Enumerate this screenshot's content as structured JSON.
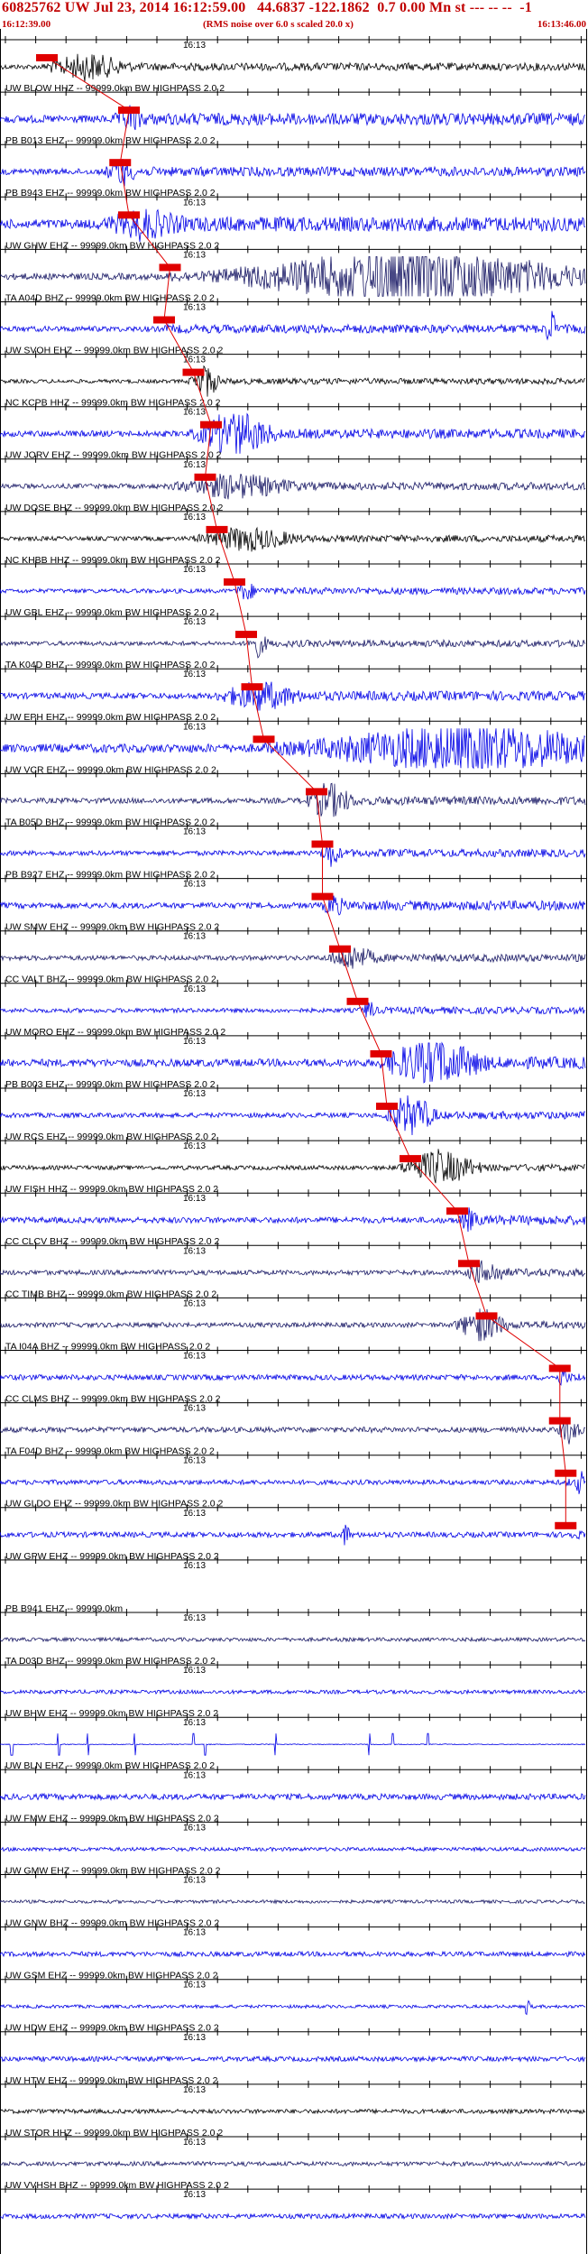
{
  "header": {
    "title": "60825762 UW Jul 23, 2014 16:12:59.00   44.6837 -122.1862  0.7 0.00 Mn st --- -- --  -1",
    "start_time": "16:12:39.00",
    "rms_note": "(RMS noise over 6.0 s scaled 20.0 x)",
    "end_time": "16:13:46.00"
  },
  "colors": {
    "trace_blue": "#0000e6",
    "trace_navy": "#1a1a66",
    "trace_black": "#000000",
    "pick_red": "#e00000",
    "axis": "#000000"
  },
  "time_tick_label": "16:13",
  "traces": [
    {
      "label": "UW BLOW HHZ -- 99999.0km BW  HIGHPASS  2.0  2",
      "color": "black",
      "pick": 0.08,
      "amp": 0.45,
      "burst_at": 0.15,
      "burst_w": 0.08,
      "burst_amp": 2.2,
      "show_tick": true
    },
    {
      "label": "PB B013 EHZ -- 99999.0km BW  HIGHPASS  2.0  2",
      "color": "blue",
      "pick": 0.22,
      "amp": 0.7,
      "burst_at": 0.22,
      "burst_w": 0.03,
      "burst_amp": 2.0,
      "show_tick": false
    },
    {
      "label": "PB B943 EHZ -- 99999.0km BW  HIGHPASS  2.0  2",
      "color": "blue",
      "pick": 0.205,
      "amp": 0.55,
      "burst_at": 0.205,
      "burst_w": 0.03,
      "burst_amp": 2.5,
      "show_tick": false
    },
    {
      "label": "UW GHW EHZ -- 99999.0km BW  HIGHPASS  2.0  2",
      "color": "blue",
      "pick": 0.22,
      "amp": 0.85,
      "burst_at": 0.24,
      "burst_w": 0.08,
      "burst_amp": 2.0,
      "show_tick": true
    },
    {
      "label": "TA A04D BHZ -- 99999.0km BW  HIGHPASS  2.0  2",
      "color": "navy",
      "pick": 0.29,
      "amp": 0.6,
      "burst_at": 0.7,
      "burst_w": 0.35,
      "burst_amp": 5.0,
      "show_tick": true
    },
    {
      "label": "UW SVOH EHZ -- 99999.0km BW  HIGHPASS  2.0  2",
      "color": "blue",
      "pick": 0.28,
      "amp": 0.5,
      "burst_at": 0.94,
      "burst_w": 0.01,
      "burst_amp": 4.0,
      "show_tick": true
    },
    {
      "label": "NC KCPB HHZ -- 99999.0km BW  HIGHPASS  2.0  2",
      "color": "black",
      "pick": 0.33,
      "amp": 0.35,
      "burst_at": 0.35,
      "burst_w": 0.03,
      "burst_amp": 3.0,
      "show_tick": true
    },
    {
      "label": "UW JORV EHZ -- 99999.0km BW  HIGHPASS  2.0  2",
      "color": "blue",
      "pick": 0.36,
      "amp": 0.55,
      "burst_at": 0.4,
      "burst_w": 0.08,
      "burst_amp": 4.0,
      "show_tick": true
    },
    {
      "label": "UW DOSE BHZ -- 99999.0km BW  HIGHPASS  2.0  2",
      "color": "navy",
      "pick": 0.35,
      "amp": 0.45,
      "burst_at": 0.4,
      "burst_w": 0.12,
      "burst_amp": 2.0,
      "show_tick": true
    },
    {
      "label": "NC KHBB HHZ -- 99999.0km BW  HIGHPASS  2.0  2",
      "color": "black",
      "pick": 0.37,
      "amp": 0.4,
      "burst_at": 0.42,
      "burst_w": 0.1,
      "burst_amp": 2.0,
      "show_tick": true
    },
    {
      "label": "UW GBL EHZ -- 99999.0km BW  HIGHPASS  2.0  2",
      "color": "blue",
      "pick": 0.4,
      "amp": 0.4,
      "burst_at": 0.42,
      "burst_w": 0.02,
      "burst_amp": 1.5,
      "show_tick": true
    },
    {
      "label": "TA K04D BHZ -- 99999.0km BW  HIGHPASS  2.0  2",
      "color": "navy",
      "pick": 0.42,
      "amp": 0.4,
      "burst_at": 0.44,
      "burst_w": 0.02,
      "burst_amp": 2.0,
      "show_tick": true
    },
    {
      "label": "UW EPH EHZ -- 99999.0km BW  HIGHPASS  2.0  2",
      "color": "blue",
      "pick": 0.43,
      "amp": 0.55,
      "burst_at": 0.44,
      "burst_w": 0.08,
      "burst_amp": 2.5,
      "show_tick": true
    },
    {
      "label": "UW VCR EHZ -- 99999.0km BW  HIGHPASS  2.0  2",
      "color": "blue",
      "pick": 0.45,
      "amp": 0.8,
      "burst_at": 0.8,
      "burst_w": 0.3,
      "burst_amp": 4.0,
      "show_tick": true
    },
    {
      "label": "TA B05D BHZ -- 99999.0km BW  HIGHPASS  2.0  2",
      "color": "navy",
      "pick": 0.54,
      "amp": 0.5,
      "burst_at": 0.56,
      "burst_w": 0.05,
      "burst_amp": 3.0,
      "show_tick": false
    },
    {
      "label": "PB B927 EHZ -- 99999.0km BW  HIGHPASS  2.0  2",
      "color": "blue",
      "pick": 0.55,
      "amp": 0.45,
      "burst_at": 0.565,
      "burst_w": 0.02,
      "burst_amp": 2.0,
      "show_tick": true
    },
    {
      "label": "UW SMW EHZ -- 99999.0km BW  HIGHPASS  2.0  2",
      "color": "blue",
      "pick": 0.55,
      "amp": 0.55,
      "burst_at": 0.57,
      "burst_w": 0.02,
      "burst_amp": 1.5,
      "show_tick": true
    },
    {
      "label": "CC VALT BHZ -- 99999.0km BW  HIGHPASS  2.0  2",
      "color": "navy",
      "pick": 0.58,
      "amp": 0.45,
      "burst_at": 0.6,
      "burst_w": 0.05,
      "burst_amp": 2.0,
      "show_tick": true
    },
    {
      "label": "UW MORO EHZ -- 99999.0km BW  HIGHPASS  2.0  2",
      "color": "blue",
      "pick": 0.61,
      "amp": 0.4,
      "burst_at": 0.63,
      "burst_w": 0.01,
      "burst_amp": 2.0,
      "show_tick": true
    },
    {
      "label": "PB B003 EHZ -- 99999.0km BW  HIGHPASS  2.0  2",
      "color": "blue",
      "pick": 0.65,
      "amp": 0.7,
      "burst_at": 0.74,
      "burst_w": 0.1,
      "burst_amp": 4.0,
      "show_tick": true
    },
    {
      "label": "UW RCS EHZ -- 99999.0km BW  HIGHPASS  2.0  2",
      "color": "blue",
      "pick": 0.66,
      "amp": 0.45,
      "burst_at": 0.7,
      "burst_w": 0.05,
      "burst_amp": 4.0,
      "show_tick": true
    },
    {
      "label": "UW FISH HHZ -- 99999.0km BW  HIGHPASS  2.0  2",
      "color": "black",
      "pick": 0.7,
      "amp": 0.4,
      "burst_at": 0.75,
      "burst_w": 0.08,
      "burst_amp": 3.0,
      "show_tick": true
    },
    {
      "label": "CC CLCV BHZ -- 99999.0km BW  HIGHPASS  2.0  2",
      "color": "blue",
      "pick": 0.78,
      "amp": 0.55,
      "burst_at": 0.8,
      "burst_w": 0.02,
      "burst_amp": 1.5,
      "show_tick": true
    },
    {
      "label": "CC TIMB BHZ -- 99999.0km BW  HIGHPASS  2.0  2",
      "color": "navy",
      "pick": 0.8,
      "amp": 0.45,
      "burst_at": 0.83,
      "burst_w": 0.04,
      "burst_amp": 2.0,
      "show_tick": true
    },
    {
      "label": "TA I04A BHZ -- 99999.0km BW  HIGHPASS  2.0  2",
      "color": "navy",
      "pick": 0.83,
      "amp": 0.45,
      "burst_at": 0.82,
      "burst_w": 0.05,
      "burst_amp": 3.0,
      "show_tick": true
    },
    {
      "label": "CC CLMS BHZ -- 99999.0km BW  HIGHPASS  2.0  2",
      "color": "blue",
      "pick": 0.955,
      "amp": 0.5,
      "burst_at": 0.96,
      "burst_w": 0.01,
      "burst_amp": 1.5,
      "show_tick": true
    },
    {
      "label": "TA F04D BHZ -- 99999.0km BW  HIGHPASS  2.0  2",
      "color": "navy",
      "pick": 0.955,
      "amp": 0.5,
      "burst_at": 0.97,
      "burst_w": 0.02,
      "burst_amp": 2.0,
      "show_tick": true
    },
    {
      "label": "UW GLDO EHZ -- 99999.0km BW  HIGHPASS  2.0  2",
      "color": "blue",
      "pick": 0.965,
      "amp": 0.45,
      "burst_at": 0.99,
      "burst_w": 0.01,
      "burst_amp": 2.0,
      "show_tick": true
    },
    {
      "label": "UW GPW EHZ -- 99999.0km BW  HIGHPASS  2.0  2",
      "color": "blue",
      "pick": 0.965,
      "amp": 0.5,
      "burst_at": 0.59,
      "burst_w": 0.01,
      "burst_amp": 2.0,
      "show_tick": true
    },
    {
      "label": "PB B941 EHZ -- 99999.0km",
      "color": "blue",
      "pick": null,
      "amp": 0.0,
      "burst_at": 0,
      "burst_w": 0,
      "burst_amp": 0,
      "show_tick": true
    },
    {
      "label": "TA D03D BHZ -- 99999.0km BW  HIGHPASS  2.0  2",
      "color": "navy",
      "pick": null,
      "amp": 0.35,
      "burst_at": 0,
      "burst_w": 0,
      "burst_amp": 0,
      "show_tick": true
    },
    {
      "label": "UW BHW EHZ -- 99999.0km BW  HIGHPASS  2.0  2",
      "color": "blue",
      "pick": null,
      "amp": 0.35,
      "burst_at": 0,
      "burst_w": 0,
      "burst_amp": 0,
      "show_tick": true
    },
    {
      "label": "UW BLN EHZ -- 99999.0km BW  HIGHPASS  2.0  2",
      "color": "blue",
      "pick": null,
      "amp": 0.08,
      "burst_at": 0,
      "burst_w": 0,
      "burst_amp": 0,
      "show_tick": true,
      "spikes": [
        0.02,
        0.1,
        0.15,
        0.23,
        0.33,
        0.35,
        0.47,
        0.63,
        0.67,
        0.73
      ]
    },
    {
      "label": "UW FMW EHZ -- 99999.0km BW  HIGHPASS  2.0  2",
      "color": "blue",
      "pick": null,
      "amp": 0.55,
      "burst_at": 0,
      "burst_w": 0,
      "burst_amp": 0,
      "show_tick": true
    },
    {
      "label": "UW GMW EHZ -- 99999.0km BW  HIGHPASS  2.0  2",
      "color": "blue",
      "pick": null,
      "amp": 0.35,
      "burst_at": 0,
      "burst_w": 0,
      "burst_amp": 0,
      "show_tick": true
    },
    {
      "label": "UW GNW BHZ -- 99999.0km BW  HIGHPASS  2.0  2",
      "color": "navy",
      "pick": null,
      "amp": 0.3,
      "burst_at": 0,
      "burst_w": 0,
      "burst_amp": 0,
      "show_tick": true
    },
    {
      "label": "UW GSM EHZ -- 99999.0km BW  HIGHPASS  2.0  2",
      "color": "blue",
      "pick": null,
      "amp": 0.45,
      "burst_at": 0,
      "burst_w": 0,
      "burst_amp": 0,
      "show_tick": true
    },
    {
      "label": "UW HDW EHZ -- 99999.0km BW  HIGHPASS  2.0  2",
      "color": "blue",
      "pick": null,
      "amp": 0.3,
      "burst_at": 0.9,
      "burst_w": 0.005,
      "burst_amp": 3.0,
      "show_tick": true
    },
    {
      "label": "UW HTW EHZ -- 99999.0km BW  HIGHPASS  2.0  2",
      "color": "blue",
      "pick": null,
      "amp": 0.45,
      "burst_at": 0,
      "burst_w": 0,
      "burst_amp": 0,
      "show_tick": true
    },
    {
      "label": "UW STOR HHZ -- 99999.0km BW  HIGHPASS  2.0  2",
      "color": "black",
      "pick": null,
      "amp": 0.4,
      "burst_at": 0,
      "burst_w": 0,
      "burst_amp": 0,
      "show_tick": true
    },
    {
      "label": "UW VVHSH BHZ -- 99999.0km BW  HIGHPASS  2.0  2",
      "color": "navy",
      "pick": null,
      "amp": 0.4,
      "burst_at": 0,
      "burst_w": 0,
      "burst_amp": 0,
      "show_tick": true
    },
    {
      "label": "",
      "color": "blue",
      "pick": null,
      "amp": 0.45,
      "burst_at": 0,
      "burst_w": 0,
      "burst_amp": 0,
      "show_tick": true
    }
  ]
}
